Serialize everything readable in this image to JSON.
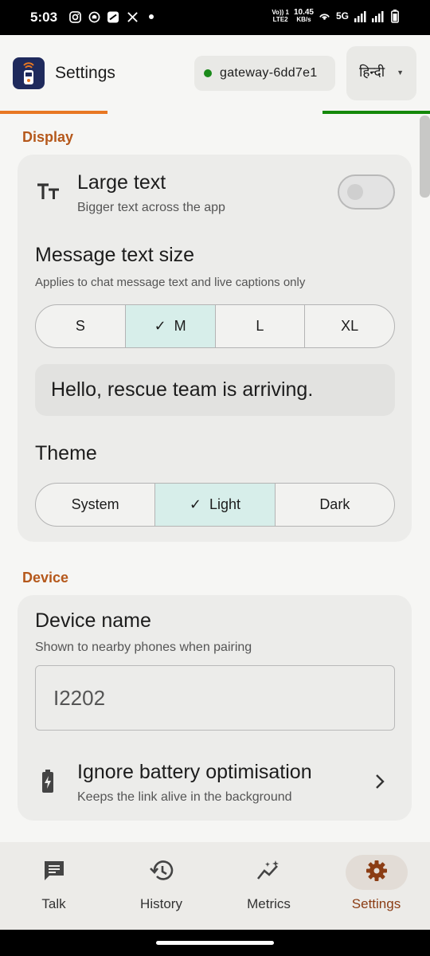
{
  "status_bar": {
    "time": "5:03",
    "volte_line1": "Vo)) 1",
    "volte_line2": "LTE2",
    "speed_value": "10.45",
    "speed_unit": "KB/s",
    "network": "5G",
    "icons": [
      "instagram-icon",
      "snapchat-icon",
      "news-icon",
      "x-icon",
      "dot-icon",
      "wifi-hotspot-icon",
      "signal-icon",
      "signal-icon-2",
      "battery-icon"
    ]
  },
  "header": {
    "title": "Settings",
    "gateway_label": "gateway-6dd7e1",
    "gateway_status_color": "#1a8a1a",
    "language_label": "हिन्दी",
    "flag_colors": [
      "#e87722",
      "#f6f6f4",
      "#f6f6f4",
      "#138808"
    ]
  },
  "display_section": {
    "label": "Display",
    "large_text": {
      "title": "Large text",
      "subtitle": "Bigger text across the app",
      "enabled": false,
      "icon": "text-size-icon"
    },
    "message_text_size": {
      "title": "Message text size",
      "subtitle": "Applies to chat message text and live captions only",
      "options": [
        "S",
        "M",
        "L",
        "XL"
      ],
      "selected": "M",
      "preview": "Hello, rescue team is arriving."
    },
    "theme": {
      "title": "Theme",
      "options": [
        "System",
        "Light",
        "Dark"
      ],
      "selected": "Light"
    }
  },
  "device_section": {
    "label": "Device",
    "device_name": {
      "title": "Device name",
      "subtitle": "Shown to nearby phones when pairing",
      "value": "I2202"
    },
    "battery": {
      "title": "Ignore battery optimisation",
      "subtitle": "Keeps the link alive in the background",
      "icon": "battery-charging-icon"
    }
  },
  "bottom_nav": {
    "items": [
      {
        "label": "Talk",
        "icon": "chat-icon"
      },
      {
        "label": "History",
        "icon": "history-icon"
      },
      {
        "label": "Metrics",
        "icon": "metrics-icon"
      },
      {
        "label": "Settings",
        "icon": "gear-icon"
      }
    ],
    "active": "Settings"
  },
  "colors": {
    "accent": "#b5581b",
    "selected_segment": "#d7eeea",
    "active_nav": "#8b3d14"
  }
}
